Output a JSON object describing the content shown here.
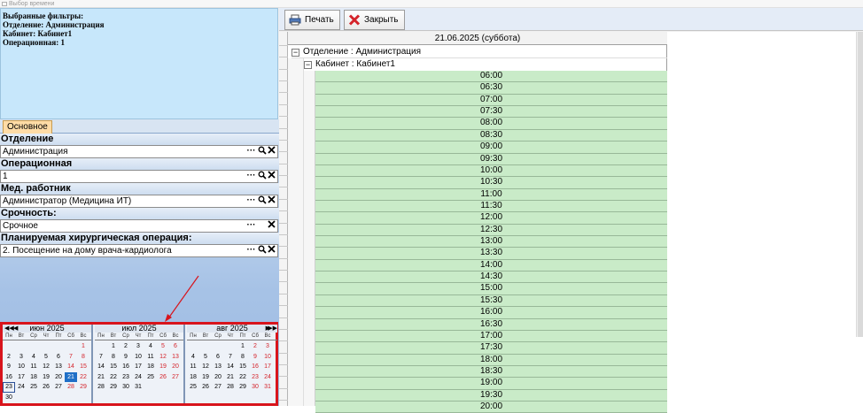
{
  "window": {
    "title": "Выбор времени"
  },
  "filters": {
    "heading": "Выбранные фильтры:",
    "lines": [
      "Отделение: Администрация",
      "Кабинет: Кабинет1",
      "Операционная: 1"
    ]
  },
  "tabs": {
    "main": "Основное"
  },
  "form": {
    "department": {
      "label": "Отделение",
      "value": "Администрация"
    },
    "operating_room": {
      "label": "Операционная",
      "value": "1"
    },
    "doctor": {
      "label": "Мед. работник",
      "value": "Администратор (Медицина ИТ)"
    },
    "urgency": {
      "label": "Срочность:",
      "value": "Срочное"
    },
    "surgery": {
      "label": "Планируемая хирургическая операция:",
      "value": "2. Посещение на дому врача-кардиолога"
    },
    "button_glyphs": {
      "dots": "···",
      "search": "🔍",
      "clear": "✕"
    }
  },
  "calendar": {
    "weekdays": [
      "Пн",
      "Вт",
      "Ср",
      "Чт",
      "Пт",
      "Сб",
      "Вс"
    ],
    "nav": {
      "prev_year": "◀◀",
      "prev": "◀",
      "next": "▶",
      "next_year": "▶▶"
    },
    "months": [
      {
        "title": "июн 2025",
        "offset": 6,
        "days": 30,
        "selected": 21,
        "today": 23
      },
      {
        "title": "июл 2025",
        "offset": 1,
        "days": 31
      },
      {
        "title": "авг 2025",
        "offset": 4,
        "days": 31
      }
    ]
  },
  "toolbar": {
    "print_label": "Печать",
    "close_label": "Закрыть"
  },
  "schedule": {
    "date_header": "21.06.2025 (суббота)",
    "group_department": "Отделение : Администрация",
    "group_room": "Кабинет : Кабинет1",
    "toggle_glyph": "−",
    "slots": [
      "06:00",
      "06:30",
      "07:00",
      "07:30",
      "08:00",
      "08:30",
      "09:00",
      "09:30",
      "10:00",
      "10:30",
      "11:00",
      "11:30",
      "12:00",
      "12:30",
      "13:00",
      "13:30",
      "14:00",
      "14:30",
      "15:00",
      "15:30",
      "16:00",
      "16:30",
      "17:00",
      "17:30",
      "18:00",
      "18:30",
      "19:00",
      "19:30",
      "20:00"
    ]
  },
  "colors": {
    "slot_green": "#c9ebc8",
    "calendar_border": "#d8141c",
    "selected_day": "#1f6fc7",
    "weekend": "#d4232a"
  }
}
